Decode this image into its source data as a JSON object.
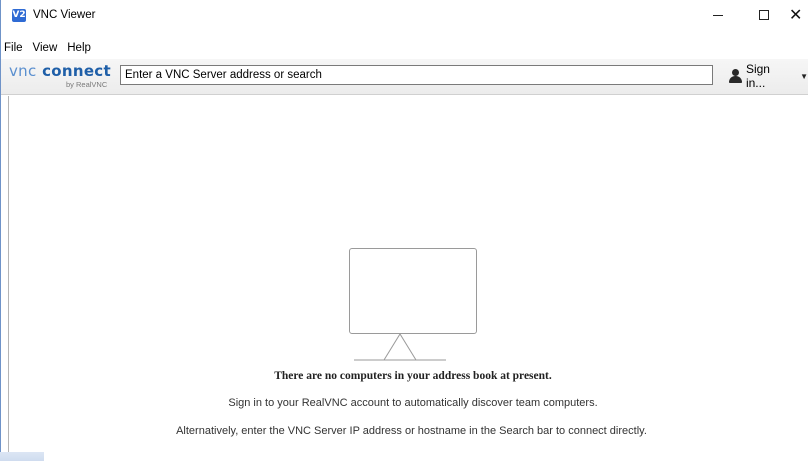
{
  "window": {
    "title": "VNC Viewer",
    "app_icon_text": "V2",
    "controls": [
      "minimize",
      "maximize",
      "close"
    ]
  },
  "menu": {
    "items": [
      {
        "label": "File"
      },
      {
        "label": "View"
      },
      {
        "label": "Help"
      }
    ]
  },
  "toolbar": {
    "logo_main": "vnc",
    "logo_main2": "connect",
    "logo_sub": "by RealVNC",
    "search_placeholder": "Enter a VNC Server address or search",
    "signin_label": "Sign in...",
    "user_icon": "user-icon"
  },
  "empty_state": {
    "icon": "monitor-icon",
    "title": "There are no computers in your address book at present.",
    "line1": "Sign in to your RealVNC account to automatically discover team computers.",
    "line2": "Alternatively, enter the VNC Server IP address or hostname in the Search bar to connect directly."
  },
  "colors": {
    "brand": "#1f5fa8",
    "app_icon": "#2f6bd4"
  }
}
